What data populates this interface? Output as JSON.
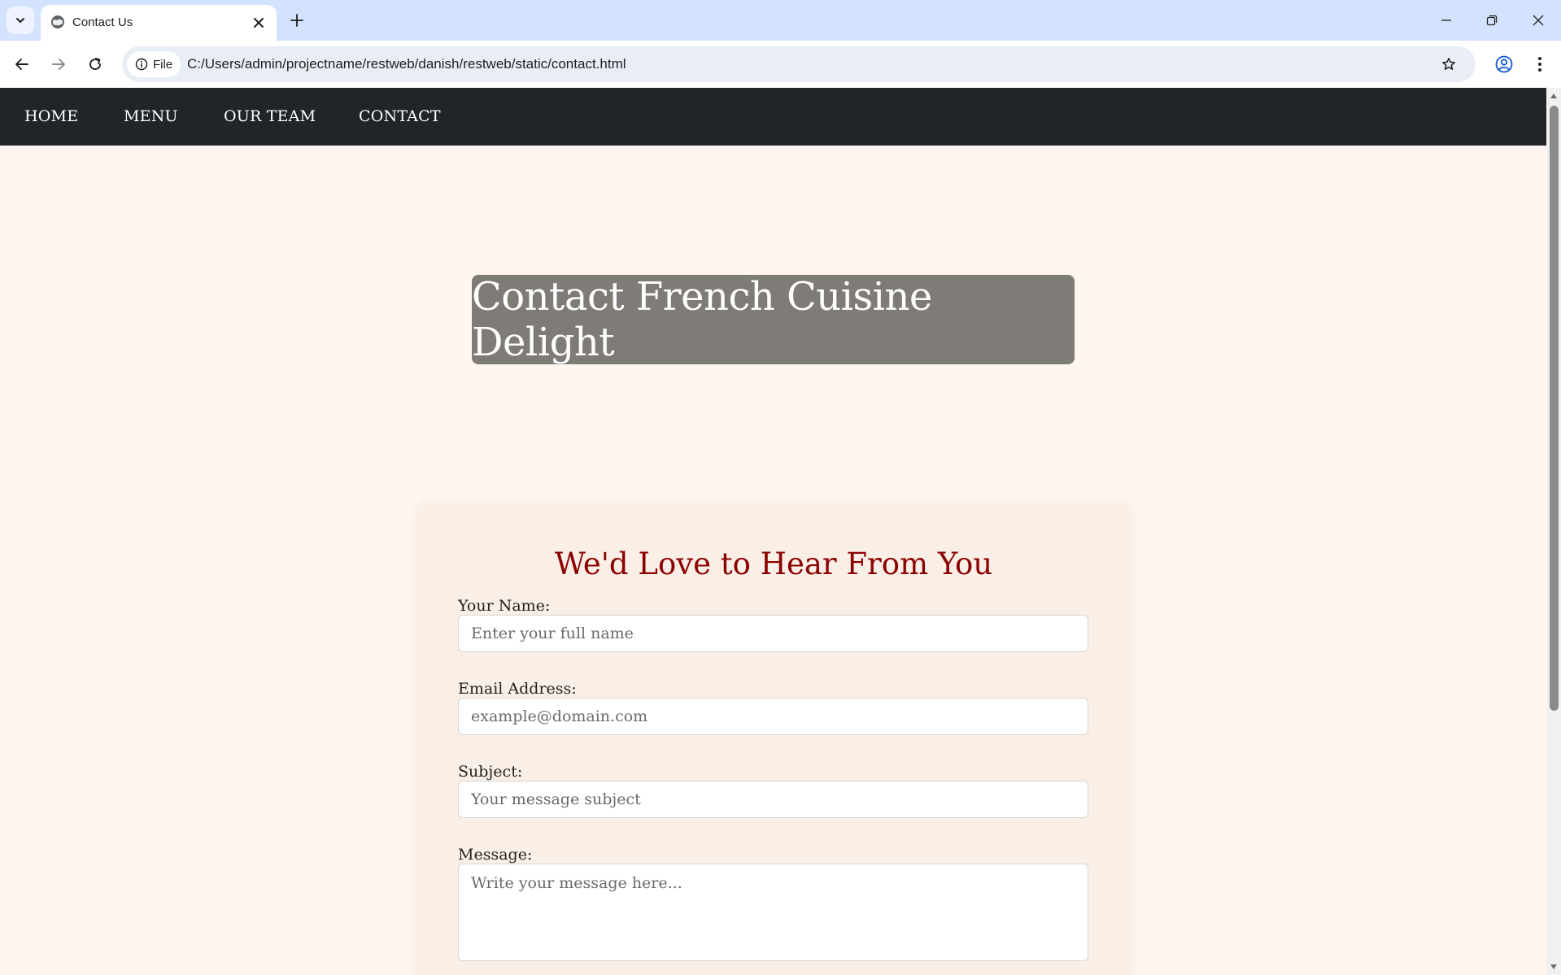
{
  "browser": {
    "tab_title": "Contact Us",
    "site_chip_label": "File",
    "url": "C:/Users/admin/projectname/restweb/danish/restweb/static/contact.html",
    "icons": {
      "tab_list": "chevron-down-icon",
      "favicon": "globe-icon",
      "tab_close": "close-icon",
      "new_tab": "plus-icon",
      "back": "arrow-left-icon",
      "forward": "arrow-right-icon",
      "reload": "reload-icon",
      "site_info": "info-icon",
      "bookmark": "star-icon",
      "profile": "account-icon",
      "menu": "kebab-icon",
      "minimize": "minimize-icon",
      "restore": "restore-icon",
      "close_window": "close-icon"
    }
  },
  "site": {
    "nav": {
      "home": "HOME",
      "menu": "MENU",
      "team": "OUR TEAM",
      "contact": "CONTACT"
    },
    "hero_title": "Contact French Cuisine Delight",
    "form": {
      "heading": "We'd Love to Hear From You",
      "name_label": "Your Name:",
      "name_placeholder": "Enter your full name",
      "email_label": "Email Address:",
      "email_placeholder": "example@domain.com",
      "subject_label": "Subject:",
      "subject_placeholder": "Your message subject",
      "message_label": "Message:",
      "message_placeholder": "Write your message here..."
    }
  },
  "colors": {
    "tabstrip": "#d3e3fd",
    "nav_bar": "#212529",
    "page_bg": "#fff6ef",
    "hero_bg": "#7f7b77",
    "form_card_bg": "#f9efe6",
    "form_heading": "#8b0000"
  }
}
